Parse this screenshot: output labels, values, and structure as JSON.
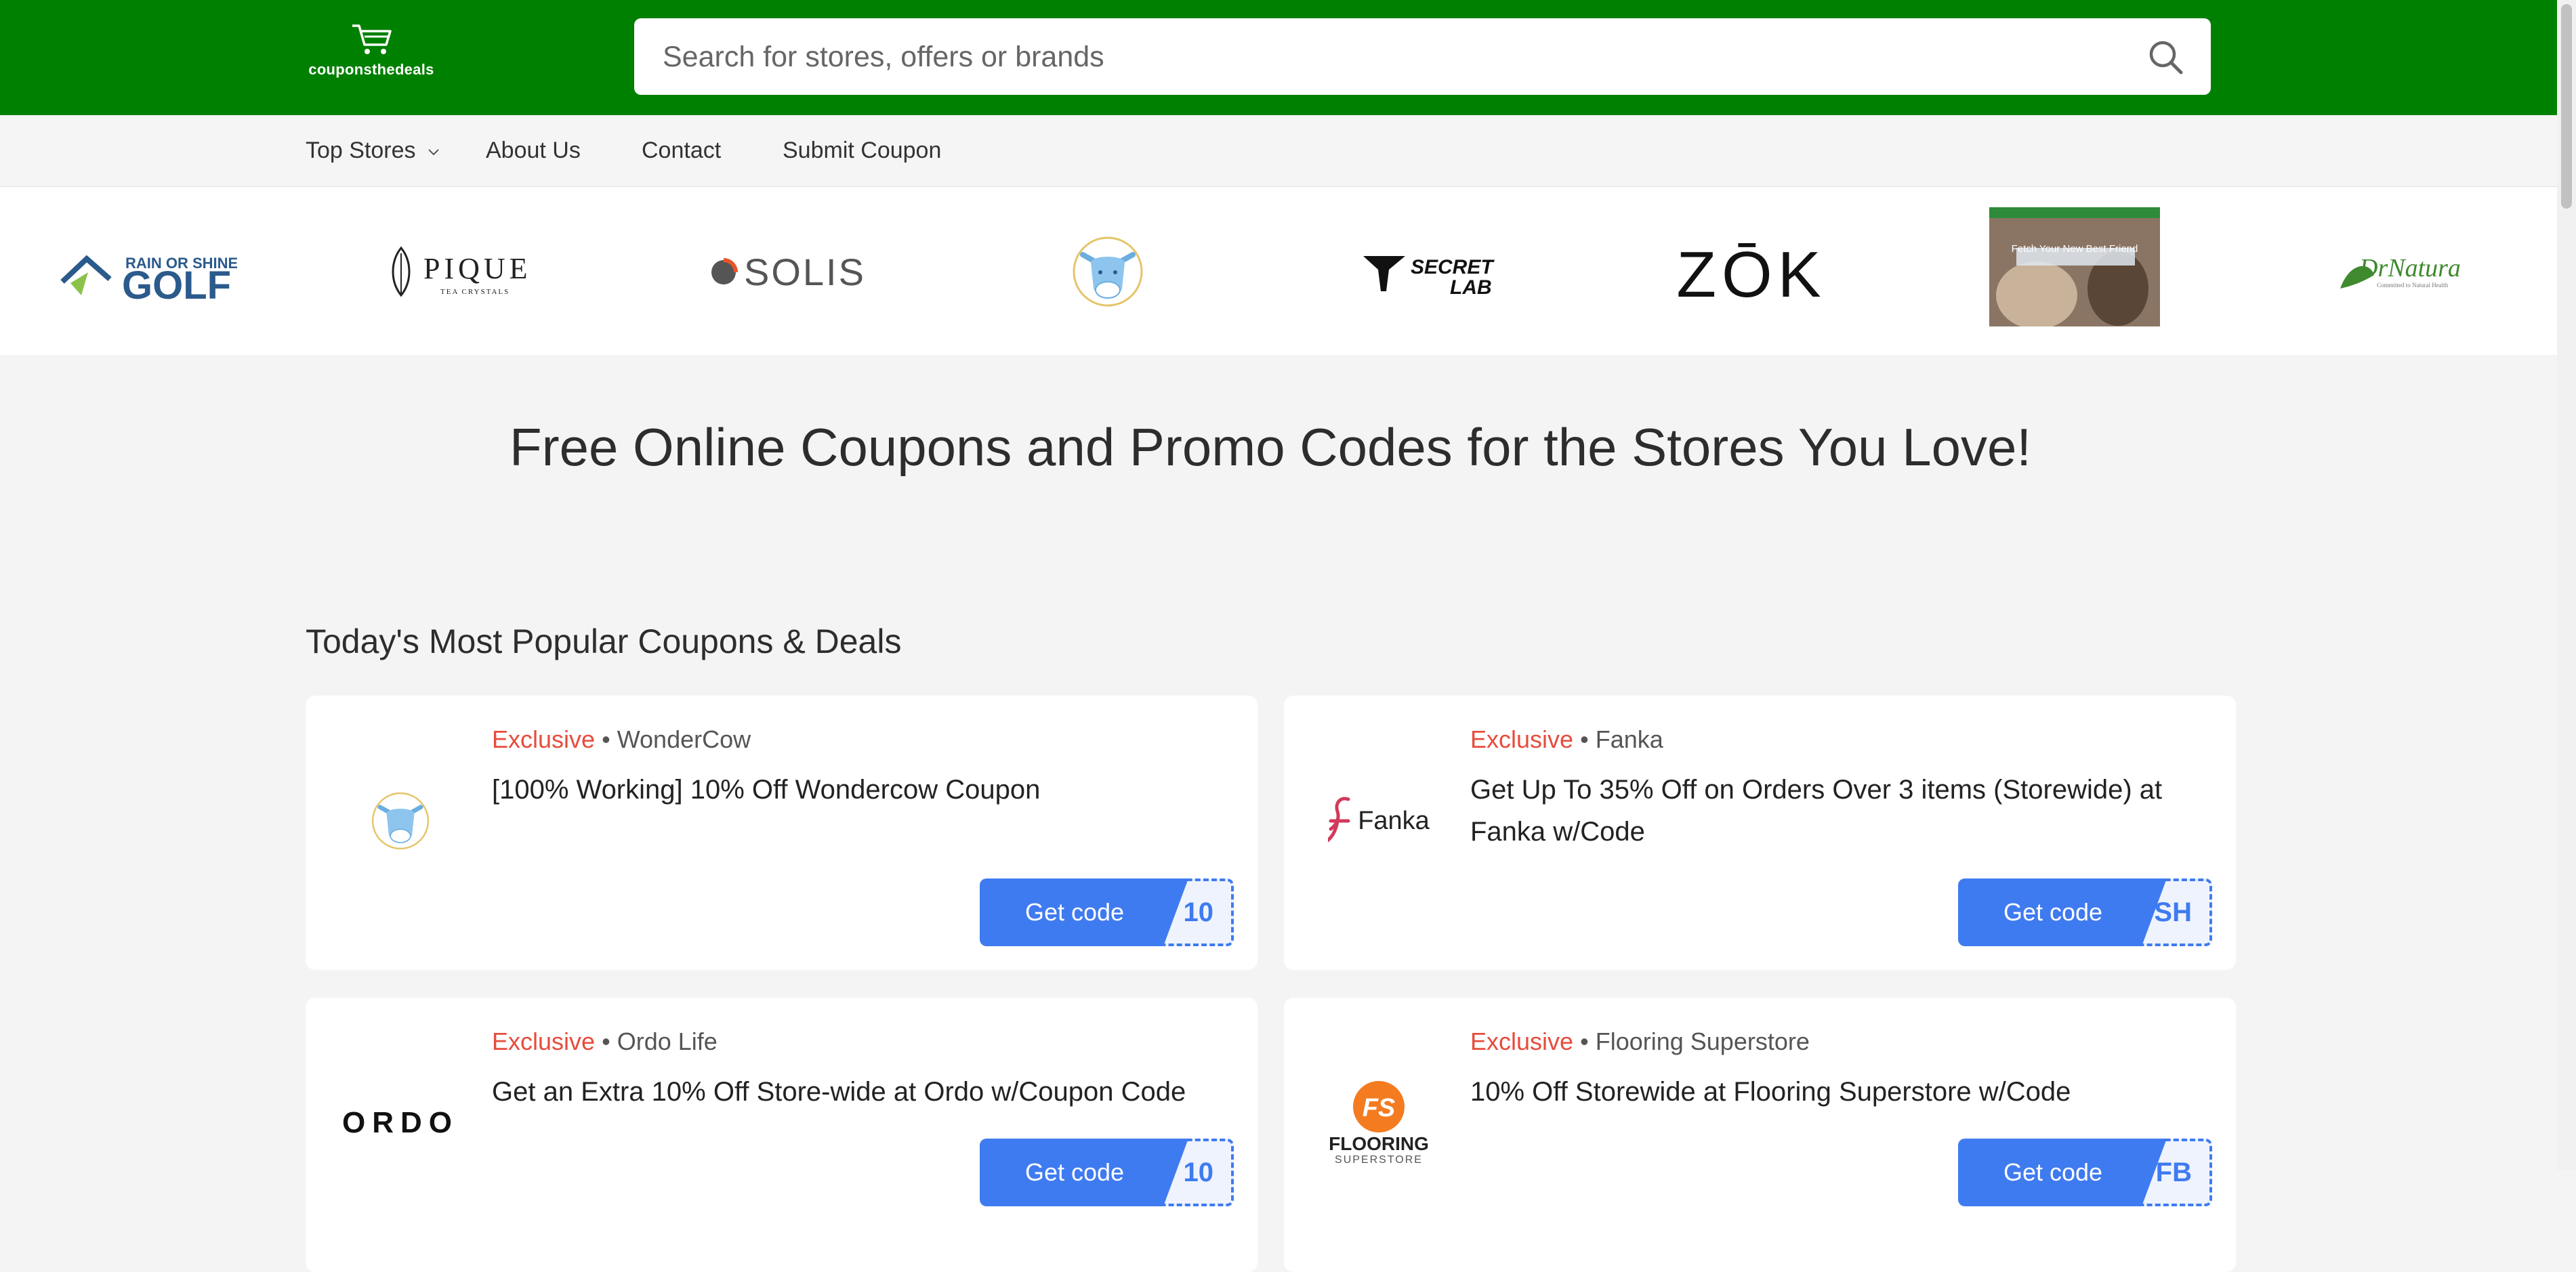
{
  "header": {
    "logo_text": "couponsthedeals",
    "search_placeholder": "Search for stores, offers or brands"
  },
  "nav": {
    "items": [
      {
        "label": "Top Stores"
      },
      {
        "label": "About Us"
      },
      {
        "label": "Contact"
      },
      {
        "label": "Submit Coupon"
      }
    ]
  },
  "store_logos": [
    {
      "name": "Rain or Shine Golf",
      "line1": "RAIN OR SHINE",
      "line2": "GOLF"
    },
    {
      "name": "Pique Tea Crystals",
      "line1": "PIQUE",
      "line2": "TEA CRYSTALS"
    },
    {
      "name": "Solis",
      "line1": "SOLIS"
    },
    {
      "name": "WonderCow",
      "icon": "cow-icon"
    },
    {
      "name": "Secretlab",
      "line1": "SECRET",
      "line2": "LAB"
    },
    {
      "name": "ZOK",
      "line1": "ZŌK"
    },
    {
      "name": "Pet adoption site",
      "line1": "Fetch Your New Best Friend"
    },
    {
      "name": "Dr Natura",
      "line1": "DrNatura"
    }
  ],
  "hero": {
    "title": "Free Online Coupons and Promo Codes for the Stores You Love!"
  },
  "section": {
    "title": "Today's Most Popular Coupons & Deals"
  },
  "coupons": [
    {
      "tag": "Exclusive",
      "store": "WonderCow",
      "title": "[100% Working] 10% Off Wondercow Coupon",
      "button": "Get code",
      "code_peek": "10",
      "logo_text": ""
    },
    {
      "tag": "Exclusive",
      "store": "Fanka",
      "title": "Get Up To 35% Off on Orders Over 3 items (Storewide) at Fanka w/Code",
      "button": "Get code",
      "code_peek": "SH",
      "logo_text": "Fanka"
    },
    {
      "tag": "Exclusive",
      "store": "Ordo Life",
      "title": "Get an Extra 10% Off Store-wide at Ordo w/Coupon Code",
      "button": "Get code",
      "code_peek": "10",
      "logo_text": "ORDO"
    },
    {
      "tag": "Exclusive",
      "store": "Flooring Superstore",
      "title": "10% Off Storewide at Flooring Superstore w/Code",
      "button": "Get code",
      "code_peek": "FB",
      "logo_text": "FLOORING",
      "logo_sub": "SUPERSTORE",
      "logo_mark": "FS"
    }
  ],
  "colors": {
    "header_bg": "#008000",
    "accent": "#3f7bf0",
    "exclusive": "#e74c3c"
  },
  "separator": "•"
}
